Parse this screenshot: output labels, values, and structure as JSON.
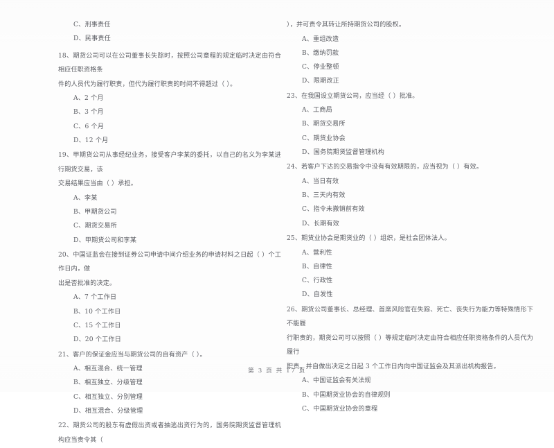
{
  "document": {
    "page_footer": "第 3 页  共 17 页",
    "text_color": "#5a5c62",
    "background_color": "#fdfdfd"
  },
  "left_column": {
    "carryover_options": [
      "C、刑事责任",
      "D、民事责任"
    ],
    "questions": [
      {
        "number": "18",
        "stem_lines": [
          "18、期货公司可以在公司董事长失踪时，按照公司章程的规定临时决定由符合相应任职资格条",
          "件的人员代为履行职责，但代为履行职责的时间不得超过（      ）。"
        ],
        "options": [
          "A、2 个月",
          "B、3 个月",
          "C、6 个月",
          "D、12 个月"
        ]
      },
      {
        "number": "19",
        "stem_lines": [
          "19、甲期货公司从事经纪业务，接受客户李某的委托，以自己的名义为李某进行期货交易，该",
          "交易结果应当由（      ）承担。"
        ],
        "options": [
          "A、李某",
          "B、甲期货公司",
          "C、期货交易所",
          "D、甲期货公司和李某"
        ]
      },
      {
        "number": "20",
        "stem_lines": [
          "20、中国证监会在接到证券公司申请中间介绍业务的申请材料之日起（      ）个工作日内，做",
          "出是否批准的决定。"
        ],
        "options": [
          "A、7 个工作日",
          "B、10 个工作日",
          "C、15 个工作日",
          "D、20 个工作日"
        ]
      },
      {
        "number": "21",
        "stem_lines": [
          "21、客户的保证金应当与期货公司的自有资产（      ）。"
        ],
        "options": [
          "A、相互混合、统一管理",
          "B、相互独立、分级管理",
          "C、相互独立、分别管理",
          "D、相互混合、分级管理"
        ]
      },
      {
        "number": "22",
        "stem_lines": [
          "22、期货公司的股东有虚假出资或者抽逃出资行为的，国务院期货监督管理机构应当责令其（"
        ],
        "options": []
      }
    ]
  },
  "right_column": {
    "carryover_stem": "），并可责令其转让所持期货公司的股权。",
    "carryover_options": [
      "A、重组改造",
      "B、缴纳罚款",
      "C、停业整顿",
      "D、限期改正"
    ],
    "questions": [
      {
        "number": "23",
        "stem_lines": [
          "23、在我国设立期货公司，应当经（      ）批准。"
        ],
        "options": [
          "A、工商局",
          "B、期货交易所",
          "C、期货业协会",
          "D、国务院期货监督管理机构"
        ]
      },
      {
        "number": "24",
        "stem_lines": [
          "24、若客户下达的交易指令中没有有效期限的，应当视为（      ）有效。"
        ],
        "options": [
          "A、当日有效",
          "B、三天内有效",
          "C、指令未撤销前有效",
          "D、长期有效"
        ]
      },
      {
        "number": "25",
        "stem_lines": [
          "25、期货业协会是期货业的（      ）组织，是社会团体法人。"
        ],
        "options": [
          "A、营利性",
          "B、自律性",
          "C、行政性",
          "D、自发性"
        ]
      },
      {
        "number": "26",
        "stem_lines": [
          "26、期货公司董事长、总经理、首席风险官在失踪、死亡、丧失行为能力等特殊情形下不能履",
          "行职责的，期货公司可以按照（    ）等规定临时决定由符合相应任职资格条件的人员代为履行",
          "职责，并自做出决定之日起 3 个工作日内向中国证监会及其派出机构报告。"
        ],
        "options": [
          "A、中国证监会有关法规",
          "B、中国期货业协会的自律规则",
          "C、中国期货业协会的章程"
        ]
      }
    ]
  }
}
